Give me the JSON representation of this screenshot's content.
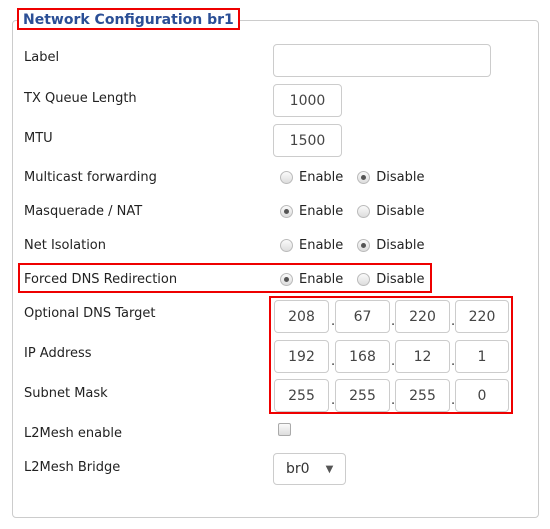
{
  "section": {
    "title": "Network Configuration br1"
  },
  "fields": {
    "label": {
      "label": "Label",
      "value": ""
    },
    "txqueue": {
      "label": "TX Queue Length",
      "value": "1000"
    },
    "mtu": {
      "label": "MTU",
      "value": "1500"
    },
    "multicast": {
      "label": "Multicast forwarding",
      "enable": "Enable",
      "disable": "Disable",
      "selected": "Disable"
    },
    "masquerade": {
      "label": "Masquerade / NAT",
      "enable": "Enable",
      "disable": "Disable",
      "selected": "Enable"
    },
    "isolation": {
      "label": "Net Isolation",
      "enable": "Enable",
      "disable": "Disable",
      "selected": "Disable"
    },
    "forced_dns": {
      "label": "Forced DNS Redirection",
      "enable": "Enable",
      "disable": "Disable",
      "selected": "Enable"
    },
    "dns_target": {
      "label": "Optional DNS Target",
      "octets": [
        "208",
        "67",
        "220",
        "220"
      ]
    },
    "ip_address": {
      "label": "IP Address",
      "octets": [
        "192",
        "168",
        "12",
        "1"
      ]
    },
    "subnet_mask": {
      "label": "Subnet Mask",
      "octets": [
        "255",
        "255",
        "255",
        "0"
      ]
    },
    "l2mesh_enable": {
      "label": "L2Mesh enable",
      "checked": false
    },
    "l2mesh_bridge": {
      "label": "L2Mesh Bridge",
      "value": "br0",
      "arrow": "▼"
    }
  },
  "separator": "."
}
